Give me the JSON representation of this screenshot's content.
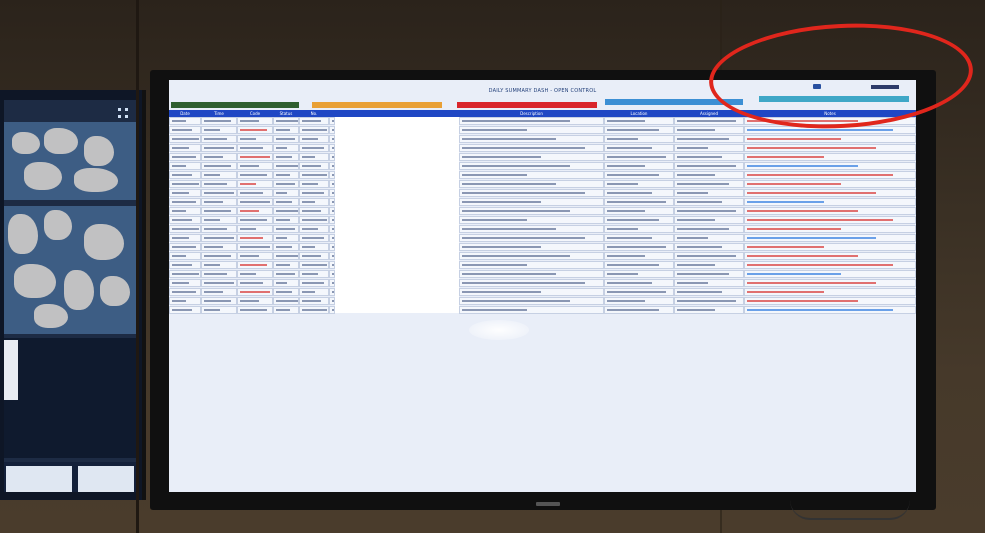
{
  "dashboard": {
    "title": "DAILY SUMMARY DASH - OPEN CONTROL",
    "logo_left_text": "",
    "groups": [
      {
        "label": "",
        "color": "#2f5f2f"
      },
      {
        "label": "",
        "color": "#e9a035"
      },
      {
        "label": "",
        "color": "#d9252b"
      },
      {
        "label": "",
        "color": "#3c8fd4"
      },
      {
        "label": "",
        "color": "#3fa7c7"
      }
    ],
    "columns": [
      "Date",
      "Time",
      "Code",
      "Status",
      "No.",
      "",
      "Description",
      "Location",
      "Assigned",
      "Notes"
    ],
    "rows_count_visible": 22
  },
  "annotation": {
    "color": "#e0261c",
    "shape": "ellipse"
  },
  "colors": {
    "header_blue": "#1f47c4",
    "screen_bg": "#e9eef8",
    "table_bg": "#f4f7fc"
  }
}
